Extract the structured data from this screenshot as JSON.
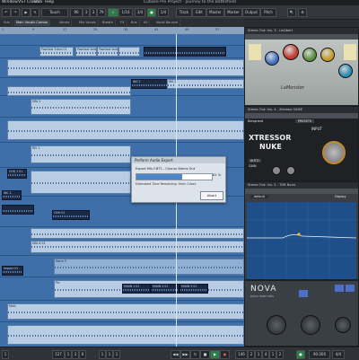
{
  "menubar": {
    "items": [
      "Window",
      "VST Cloud",
      "Hub",
      "Help"
    ],
    "window_title": "Cubase Pro Project - Journey to the Battlefield"
  },
  "toolbar": {
    "fields": [
      "Touch",
      "90",
      "3",
      "3",
      "79",
      "1/16",
      "3/4",
      "1/4"
    ],
    "tabs": [
      "Track",
      "Edit",
      "Master",
      "Marker",
      "Output",
      "Pitch"
    ]
  },
  "track_tabs": [
    "Sub",
    "Main Vocals Combo",
    "Vocals",
    "Mix Vocals",
    "Breath",
    "FX",
    "Bus",
    "All",
    "Vocal Bounce"
  ],
  "ruler": {
    "marks": [
      "1",
      "9",
      "17",
      "25",
      "33",
      "41",
      "49",
      "57"
    ]
  },
  "arrange": {
    "clip_labels": {
      "pasthest": "Pasthest 5dlnd 01",
      "pasthest_a": "Pasthest Adla",
      "pasthest_b": "Pasthest Adla",
      "ins": "INS 2",
      "ins_b": "INS 2",
      "dbl": "DBL 2",
      "rei": "REI 1",
      "chq": "CHQ 1 01",
      "inc": "INC 1",
      "ooh": "OOH 01",
      "dbl_vb": "DBL 6 01",
      "harm": "Harm 5",
      "prc": "Prc",
      "main": "Main",
      "impact": "Impact 01",
      "mixin1": "MIXIN 1 01",
      "mixin2": "MIXIN 2 01",
      "mixin3": "MIXIN 3 01"
    }
  },
  "export_dialog": {
    "title": "Perform Audio Export",
    "message": "Export Mix F.BT1 - Chorus Stems Out",
    "progress": 0.61,
    "percent_label": "61 %",
    "estimate": "Estimated Time Remaining: 0min 15sec",
    "abort_label": "Abort"
  },
  "transport": {
    "fields": [
      "1",
      "127",
      "1",
      "3",
      "6",
      "1",
      "1",
      "1",
      "146",
      "2",
      "1",
      "4",
      "1",
      "2"
    ],
    "bpm": "90.000",
    "sig": "4/4"
  },
  "plugins": {
    "lalo": {
      "title": "Stereo Out: Ins. 3 - LeAlbert",
      "brand": "LaMonster",
      "knob_colors": [
        "#3f6fc2",
        "#c43a2e",
        "#5a8d3c",
        "#c49a24",
        "#2d8ab0"
      ]
    },
    "xtressor": {
      "title": "Stereo Out: Ins. 4 - Xtressor NUKE",
      "brand": "Klevgrand",
      "name_top": "XTRESSOR",
      "name_bottom": "NUKE",
      "input_label": "INPUT",
      "presets_label": "PRESETS",
      "auto_label": "AUTO",
      "gain_label": "GAIN"
    },
    "eq": {
      "title": "Stereo Out: Ins. 5 - TDR Nova",
      "preset": "default",
      "tag": "Display"
    },
    "nova": {
      "name": "NOVA",
      "vendor": "tokyo dawn labs"
    }
  }
}
